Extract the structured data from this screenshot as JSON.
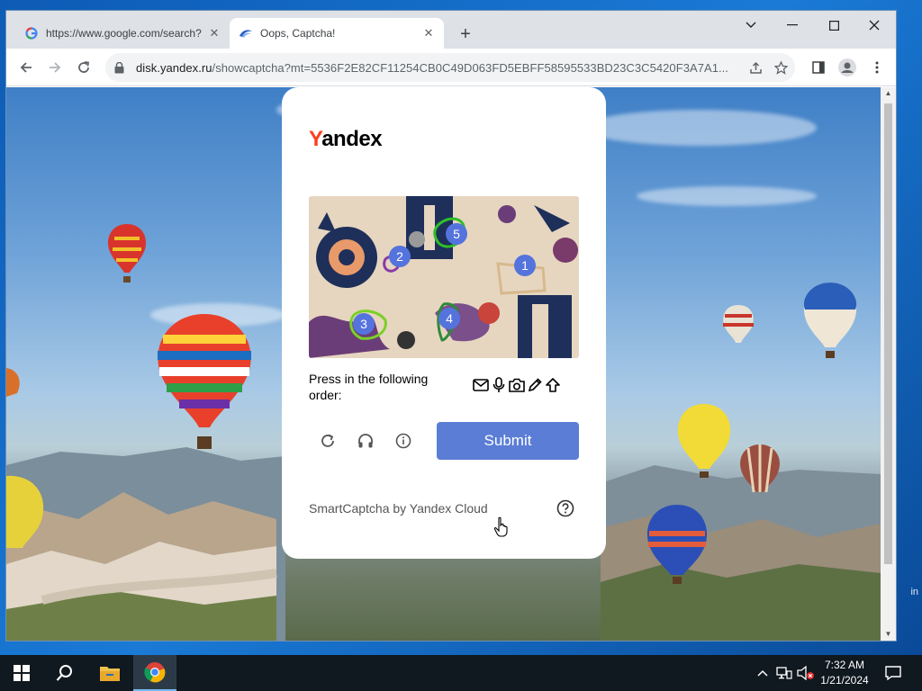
{
  "browser": {
    "tabs": [
      {
        "title": "https://www.google.com/search?",
        "favicon": "google-icon",
        "active": false
      },
      {
        "title": "Oops, Captcha!",
        "favicon": "yandex-disk-icon",
        "active": true
      }
    ],
    "new_tab_label": "+",
    "address": {
      "host": "disk.yandex.ru",
      "path": "/showcaptcha?mt=5536F2E82CF11254CB0C49D063FD5EBFF58595533BD23C3C5420F3A7A1..."
    },
    "icons": {
      "back": "back-arrow-icon",
      "forward": "forward-arrow-icon",
      "reload": "reload-icon",
      "lock": "lock-icon",
      "share": "share-icon",
      "bookmark": "star-icon",
      "sidepanel": "side-panel-icon",
      "profile": "profile-icon",
      "menu": "kebab-menu-icon"
    }
  },
  "captcha": {
    "logo": {
      "first": "Y",
      "rest": "andex"
    },
    "marker_labels": [
      "1",
      "2",
      "3",
      "4",
      "5"
    ],
    "instruction": "Press in the following order:",
    "order_icons": [
      "envelope-icon",
      "microphone-icon",
      "camera-icon",
      "pencil-icon",
      "upload-arrow-icon"
    ],
    "controls": [
      "refresh-icon",
      "audio-headphones-icon",
      "info-icon"
    ],
    "submit_label": "Submit",
    "footer": "SmartCaptcha by Yandex Cloud",
    "colors": {
      "accent": "#5b7dd6",
      "logo_red": "#fc3f1d"
    }
  },
  "desktop": {
    "edge_text": "in"
  },
  "taskbar": {
    "time": "7:32 AM",
    "date": "1/21/2024",
    "items": [
      "start-icon",
      "search-icon",
      "file-explorer-icon",
      "chrome-icon"
    ]
  }
}
